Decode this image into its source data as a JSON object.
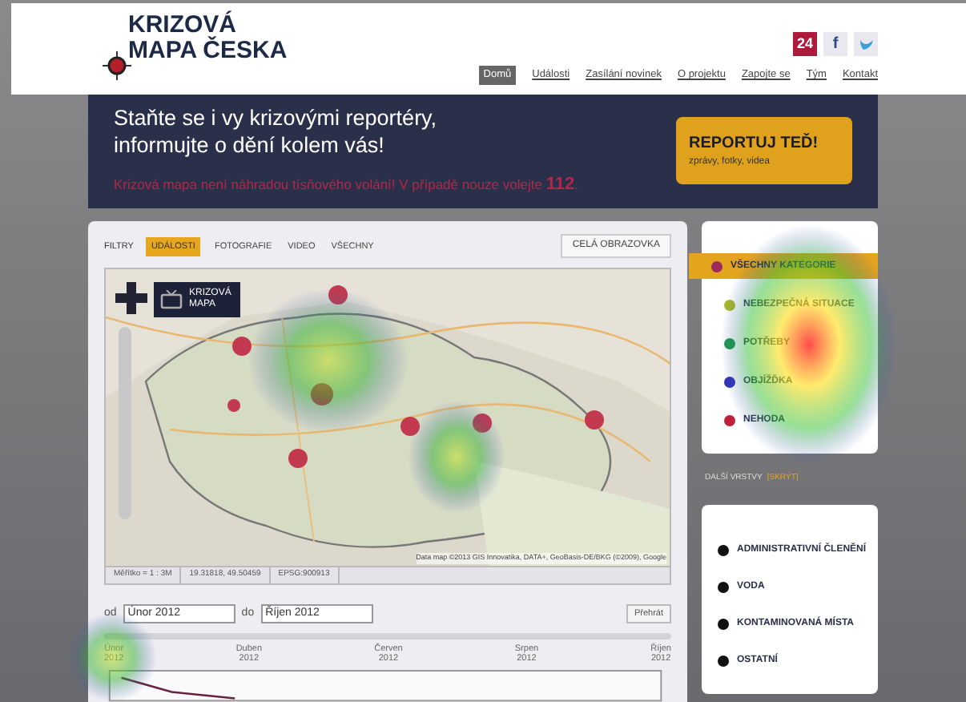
{
  "header": {
    "logo": [
      "KRIZOVÁ",
      "MAPA ČESKA"
    ],
    "social": [
      "24",
      "f"
    ],
    "nav": [
      {
        "label": "Domů",
        "selected": true
      },
      {
        "label": "Události",
        "selected": false
      },
      {
        "label": "Zasílání novinek",
        "selected": false
      },
      {
        "label": "O projektu",
        "selected": false
      },
      {
        "label": "Zapojte se",
        "selected": false
      },
      {
        "label": "Tým",
        "selected": false
      },
      {
        "label": "Kontakt",
        "selected": false
      }
    ]
  },
  "banner": {
    "headline": [
      "Staňte se i vy krizovými reportéry,",
      "informujte o dění kolem vás!"
    ],
    "notice": "Krizová mapa není náhradou tísňového volání! V případě nouze volejte **112**.",
    "button": {
      "title": "REPORTUJ TEĎ!",
      "subtitle": "zprávy, fotky, videa"
    }
  },
  "map_panel": {
    "filter_label": "FILTRY",
    "filters": [
      {
        "label": "UDÁLOSTI",
        "selected": true
      },
      {
        "label": "FOTOGRAFIE",
        "selected": false
      },
      {
        "label": "VIDEO",
        "selected": false
      },
      {
        "label": "VŠECHNY",
        "selected": false
      }
    ],
    "fullscreen": "CELÁ OBRAZOVKA",
    "map_badge": [
      "KRIZOVÁ",
      "MAPA"
    ],
    "attribution": "Data map ©2013 GIS Innovatika, DATA+, GeoBasis-DE/BKG (©2009), Google",
    "status": [
      "Měřítko = 1 : 3M",
      "19.31818, 49.50459",
      "EPSG:900913"
    ],
    "timeline": {
      "from_label": "od",
      "from": "Únor 2012",
      "to_label": "do",
      "to": "Říjen 2012",
      "play": "Přehrát",
      "months": [
        [
          "Únor",
          "2012"
        ],
        [
          "Duben",
          "2012"
        ],
        [
          "Červen",
          "2012"
        ],
        [
          "Srpen",
          "2012"
        ],
        [
          "Říjen",
          "2012"
        ]
      ]
    }
  },
  "categories": [
    {
      "label": "VŠECHNY KATEGORIE",
      "color": "#9c2a5a",
      "selected": true
    },
    {
      "label": "NEBEZPEČNÁ SITUACE",
      "color": "#a8b82a",
      "selected": false
    },
    {
      "label": "POTŘEBY",
      "color": "#1f9a4a",
      "selected": false
    },
    {
      "label": "OBJÍŽĎKA",
      "color": "#3434b8",
      "selected": false
    },
    {
      "label": "NEHODA",
      "color": "#c0203a",
      "selected": false
    }
  ],
  "layers_toggle": {
    "label": "DALŠÍ VRSTVY",
    "action": "[SKRÝT]"
  },
  "layers": [
    "ADMINISTRATIVNÍ ČLENĚNÍ",
    "VODA",
    "KONTAMINOVANÁ MÍSTA",
    "OSTATNÍ"
  ]
}
